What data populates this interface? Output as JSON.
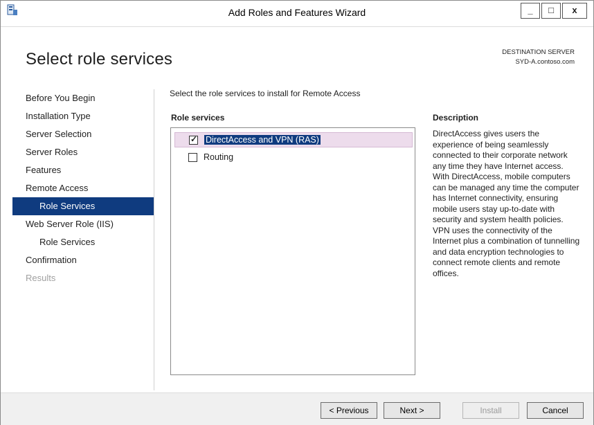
{
  "window": {
    "title": "Add Roles and Features Wizard",
    "min_label": "_",
    "max_label": "□",
    "close_label": "x"
  },
  "header": {
    "page_title": "Select role services",
    "destination_label": "DESTINATION SERVER",
    "destination_server": "SYD-A.contoso.com"
  },
  "nav": {
    "items": [
      {
        "label": "Before You Begin",
        "state": "normal",
        "level": 0
      },
      {
        "label": "Installation Type",
        "state": "normal",
        "level": 0
      },
      {
        "label": "Server Selection",
        "state": "normal",
        "level": 0
      },
      {
        "label": "Server Roles",
        "state": "normal",
        "level": 0
      },
      {
        "label": "Features",
        "state": "normal",
        "level": 0
      },
      {
        "label": "Remote Access",
        "state": "normal",
        "level": 0
      },
      {
        "label": "Role Services",
        "state": "active",
        "level": 1
      },
      {
        "label": "Web Server Role (IIS)",
        "state": "normal",
        "level": 0
      },
      {
        "label": "Role Services",
        "state": "normal",
        "level": 1
      },
      {
        "label": "Confirmation",
        "state": "normal",
        "level": 0
      },
      {
        "label": "Results",
        "state": "disabled",
        "level": 0
      }
    ]
  },
  "main": {
    "instruction": "Select the role services to install for Remote Access",
    "role_services_header": "Role services",
    "role_services": [
      {
        "label": "DirectAccess and VPN (RAS)",
        "checked": true,
        "selected": true
      },
      {
        "label": "Routing",
        "checked": false,
        "selected": false
      }
    ],
    "description_header": "Description",
    "description_text": "DirectAccess gives users the experience of being seamlessly connected to their corporate network any time they have Internet access. With DirectAccess, mobile computers can be managed any time the computer has Internet connectivity, ensuring mobile users stay up-to-date with security and system health policies. VPN uses the connectivity of the Internet plus a combination of tunnelling and data encryption technologies to connect remote clients and remote offices."
  },
  "footer": {
    "previous_label": "< Previous",
    "next_label": "Next >",
    "install_label": "Install",
    "cancel_label": "Cancel",
    "install_enabled": false
  },
  "colors": {
    "active_nav": "#0f3b7f",
    "selection_row": "#eddcec",
    "disabled_text": "#a0a0a0"
  }
}
